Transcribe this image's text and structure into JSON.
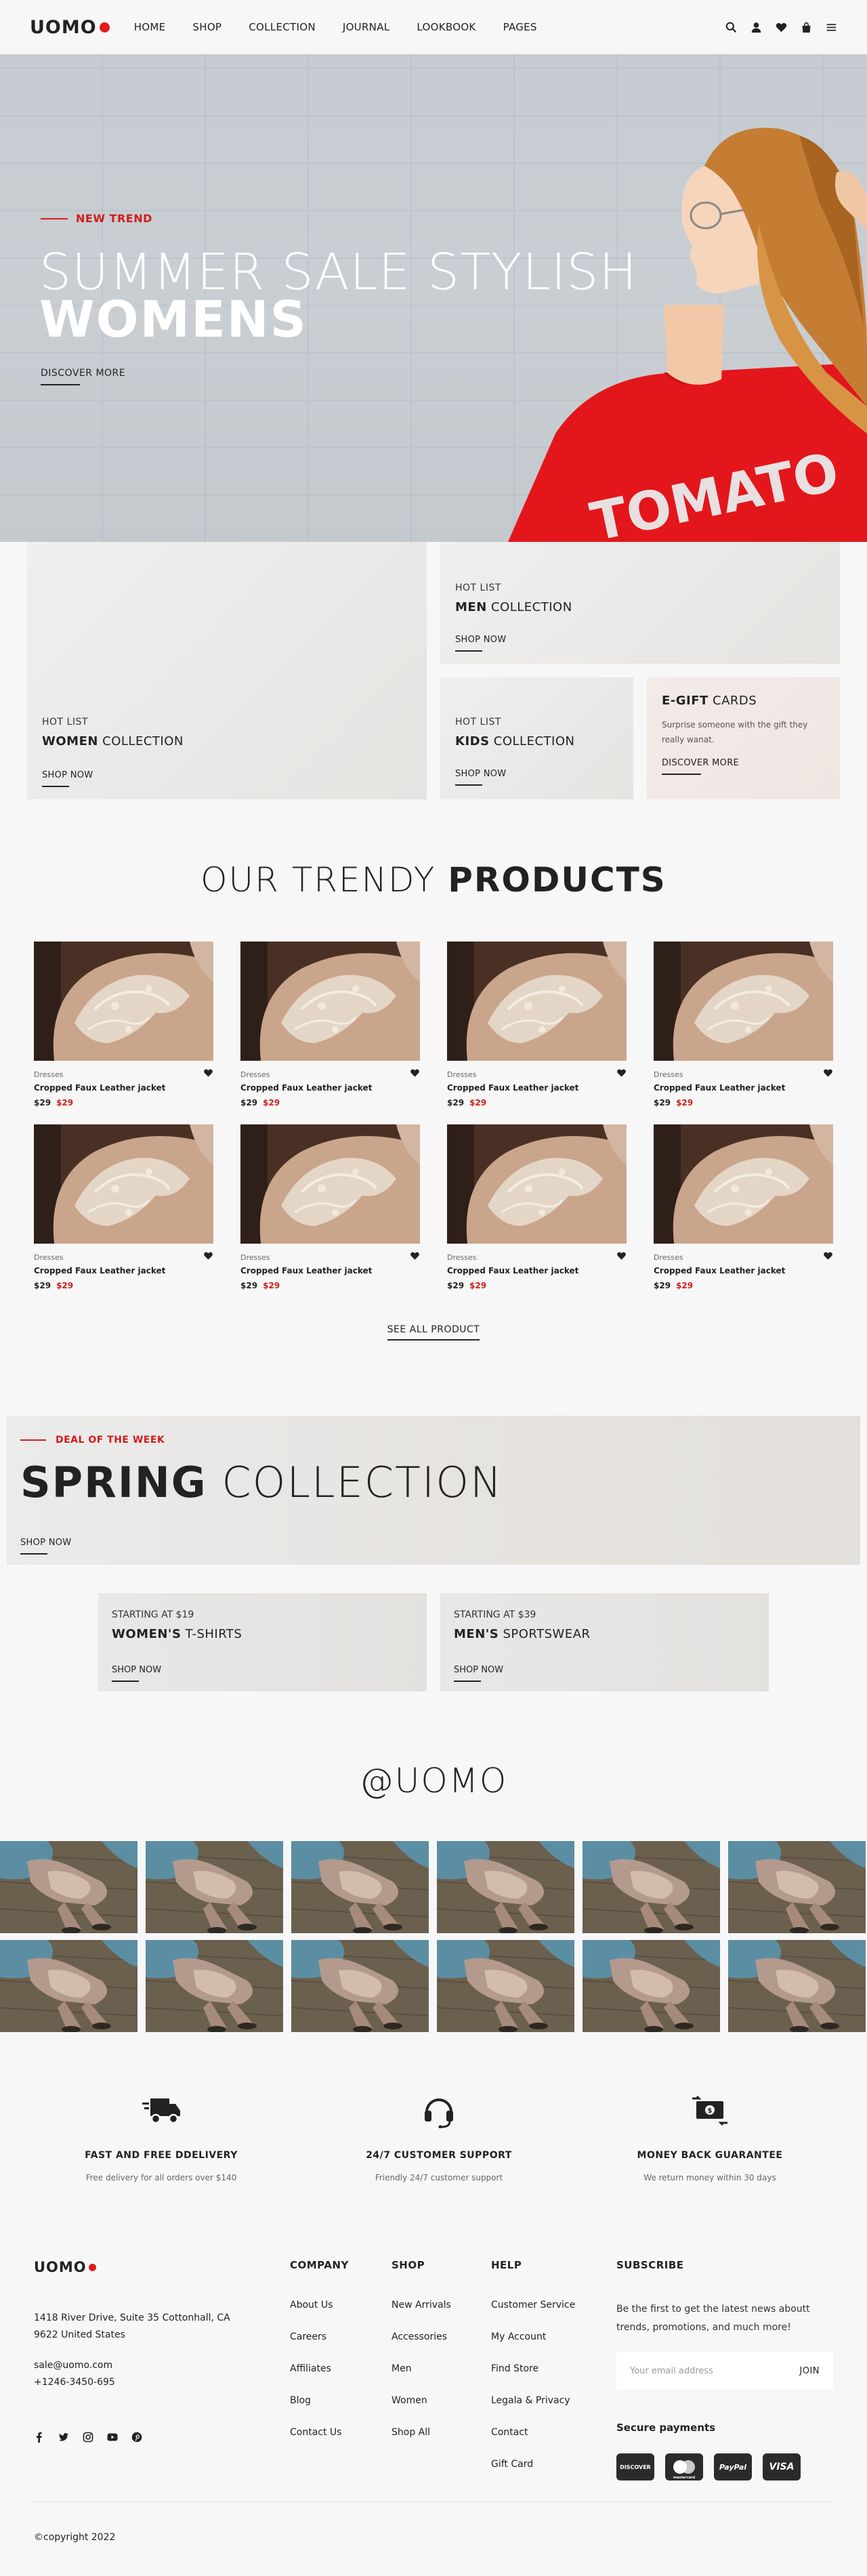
{
  "header": {
    "logo": "UOMO",
    "nav": [
      "HOME",
      "SHOP",
      "COLLECTION",
      "JOURNAL",
      "LOOKBOOK",
      "PAGES"
    ],
    "icons": [
      "search-icon",
      "user-icon",
      "heart-icon",
      "bag-icon",
      "menu-icon"
    ]
  },
  "hero": {
    "tag": "NEW TREND",
    "line1": "SUMMER SALE STYLISH",
    "line2": "WOMENS",
    "link": "DISCOVER MORE",
    "shirt_text": "TOMATO"
  },
  "collections": {
    "women": {
      "small": "HOT LIST",
      "bold": "WOMEN",
      "rest": " COLLECTION",
      "link": "SHOP NOW"
    },
    "men": {
      "small": "HOT LIST",
      "bold": "MEN",
      "rest": " COLLECTION",
      "link": "SHOP NOW"
    },
    "kids": {
      "small": "HOT LIST",
      "bold": "KIDS",
      "rest": " COLLECTION",
      "link": "SHOP NOW"
    },
    "egift": {
      "bold": "E-GIFT",
      "rest": " CARDS",
      "desc": "Surprise someone with the gift they really wanat.",
      "link": "DISCOVER MORE"
    }
  },
  "products": {
    "title_light": "OUR TRENDY ",
    "title_bold": "PRODUCTS",
    "items": [
      {
        "cat": "Dresses",
        "name": "Cropped Faux Leather jacket",
        "price": "$29",
        "sale": "$29"
      },
      {
        "cat": "Dresses",
        "name": "Cropped Faux Leather jacket",
        "price": "$29",
        "sale": "$29"
      },
      {
        "cat": "Dresses",
        "name": "Cropped Faux Leather jacket",
        "price": "$29",
        "sale": "$29"
      },
      {
        "cat": "Dresses",
        "name": "Cropped Faux Leather jacket",
        "price": "$29",
        "sale": "$29"
      },
      {
        "cat": "Dresses",
        "name": "Cropped Faux Leather jacket",
        "price": "$29",
        "sale": "$29"
      },
      {
        "cat": "Dresses",
        "name": "Cropped Faux Leather jacket",
        "price": "$29",
        "sale": "$29"
      },
      {
        "cat": "Dresses",
        "name": "Cropped Faux Leather jacket",
        "price": "$29",
        "sale": "$29"
      },
      {
        "cat": "Dresses",
        "name": "Cropped Faux Leather jacket",
        "price": "$29",
        "sale": "$29"
      }
    ],
    "see_all": "SEE ALL PRODUCT"
  },
  "deal": {
    "tag": "DEAL OF THE WEEK",
    "bold": "SPRING",
    "rest": " COLLECTION",
    "link": "SHOP NOW"
  },
  "mini_banners": {
    "womens": {
      "small": "STARTING AT $19",
      "bold": "WOMEN'S",
      "rest": " T-SHIRTS",
      "link": "SHOP NOW"
    },
    "mens": {
      "small": "STARTING AT $39",
      "bold": "MEN'S",
      "rest": " SPORTSWEAR",
      "link": "SHOP NOW"
    }
  },
  "instagram": {
    "title": "@UOMO"
  },
  "features": [
    {
      "icon": "truck-icon",
      "title": "FAST AND FREE DDELIVERY",
      "desc": "Free delivery for all orders over $140"
    },
    {
      "icon": "headset-icon",
      "title": "24/7 CUSTOMER SUPPORT",
      "desc": "Friendly 24/7 customer support"
    },
    {
      "icon": "money-icon",
      "title": "MONEY BACK GUARANTEE",
      "desc": "We return money within 30 days"
    }
  ],
  "footer": {
    "logo": "UOMO",
    "address1": "1418 River Drive, Suite 35 Cottonhall, CA",
    "address2": "9622 United States",
    "email": "sale@uomo.com",
    "phone": "+1246-3450-695",
    "social": [
      "facebook-icon",
      "twitter-icon",
      "instagram-icon",
      "youtube-icon",
      "pinterest-icon"
    ],
    "company": {
      "title": "COMPANY",
      "items": [
        "About Us",
        "Careers",
        "Affiliates",
        "Blog",
        "Contact Us"
      ]
    },
    "shop": {
      "title": "SHOP",
      "items": [
        "New Arrivals",
        "Accessories",
        "Men",
        "Women",
        "Shop All"
      ]
    },
    "help": {
      "title": "HELP",
      "items": [
        "Customer Service",
        "My Account",
        "Find Store",
        "Legala & Privacy",
        "Contact",
        "Gift Card"
      ]
    },
    "subscribe": {
      "title": "SUBSCRIBE",
      "desc": "Be the first to get the latest news aboutt trends, promotions, and much more!",
      "placeholder": "Your email address",
      "button": "JOIN"
    },
    "payments": {
      "title": "Secure payments",
      "cards": [
        "DISCOVER",
        "mastercard",
        "PayPal",
        "VISA"
      ]
    },
    "copyright": "©copyright 2022"
  }
}
